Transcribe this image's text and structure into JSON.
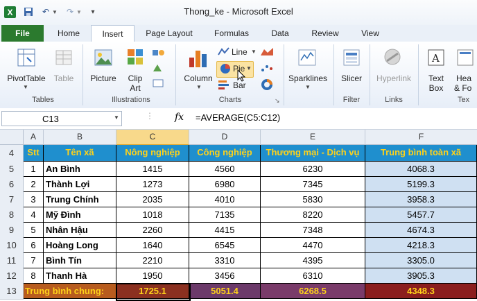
{
  "window": {
    "title": "Thong_ke  -  Microsoft Excel"
  },
  "tabs": [
    "File",
    "Home",
    "Insert",
    "Page Layout",
    "Formulas",
    "Data",
    "Review",
    "View"
  ],
  "ribbon": {
    "pivottable": "PivotTable",
    "table": "Table",
    "picture": "Picture",
    "clipart_1": "Clip",
    "clipart_2": "Art",
    "column": "Column",
    "line": "Line",
    "pie": "Pie",
    "bar": "Bar",
    "sparklines": "Sparklines",
    "slicer": "Slicer",
    "hyperlink": "Hyperlink",
    "textbox_1": "Text",
    "textbox_2": "Box",
    "header_1": "Hea",
    "header_2": "& Fo",
    "groups": {
      "tables": "Tables",
      "illustrations": "Illustrations",
      "charts": "Charts",
      "filter": "Filter",
      "links": "Links",
      "text": "Tex"
    }
  },
  "formula_bar": {
    "cell_ref": "C13",
    "fx": "fx",
    "formula": "=AVERAGE(C5:C12)"
  },
  "sheet": {
    "columns": [
      "A",
      "B",
      "C",
      "D",
      "E",
      "F"
    ],
    "header_row": "4",
    "headers": [
      "Stt",
      "Tên xã",
      "Nông nghiệp",
      "Công nghiệp",
      "Thương mại - Dịch vụ",
      "Trung bình toàn xã"
    ],
    "rows": [
      {
        "row": "5",
        "stt": "1",
        "name": "An Bình",
        "c": "1415",
        "d": "4560",
        "e": "6230",
        "f": "4068.3"
      },
      {
        "row": "6",
        "stt": "2",
        "name": "Thành Lợi",
        "c": "1273",
        "d": "6980",
        "e": "7345",
        "f": "5199.3"
      },
      {
        "row": "7",
        "stt": "3",
        "name": "Trung Chính",
        "c": "2035",
        "d": "4010",
        "e": "5830",
        "f": "3958.3"
      },
      {
        "row": "8",
        "stt": "4",
        "name": "Mỹ Đình",
        "c": "1018",
        "d": "7135",
        "e": "8220",
        "f": "5457.7"
      },
      {
        "row": "9",
        "stt": "5",
        "name": "Nhân Hậu",
        "c": "2260",
        "d": "4415",
        "e": "7348",
        "f": "4674.3"
      },
      {
        "row": "10",
        "stt": "6",
        "name": "Hoàng Long",
        "c": "1640",
        "d": "6545",
        "e": "4470",
        "f": "4218.3"
      },
      {
        "row": "11",
        "stt": "7",
        "name": "Bình Tín",
        "c": "2210",
        "d": "3310",
        "e": "4395",
        "f": "3305.0"
      },
      {
        "row": "12",
        "stt": "8",
        "name": "Thanh Hà",
        "c": "1950",
        "d": "3456",
        "e": "6310",
        "f": "3905.3"
      }
    ],
    "total_row": {
      "row": "13",
      "label": "Trung bình chung:",
      "c": "1725.1",
      "d": "5051.4",
      "e": "6268.5",
      "f": "4348.3"
    }
  },
  "colors": {
    "file_tab": "#2b7a2e",
    "header_fill": "#1f8fce",
    "header_text": "#ffd21a",
    "avg_fill": "#cfe0f2",
    "total_fill": "#8b1e1e"
  }
}
